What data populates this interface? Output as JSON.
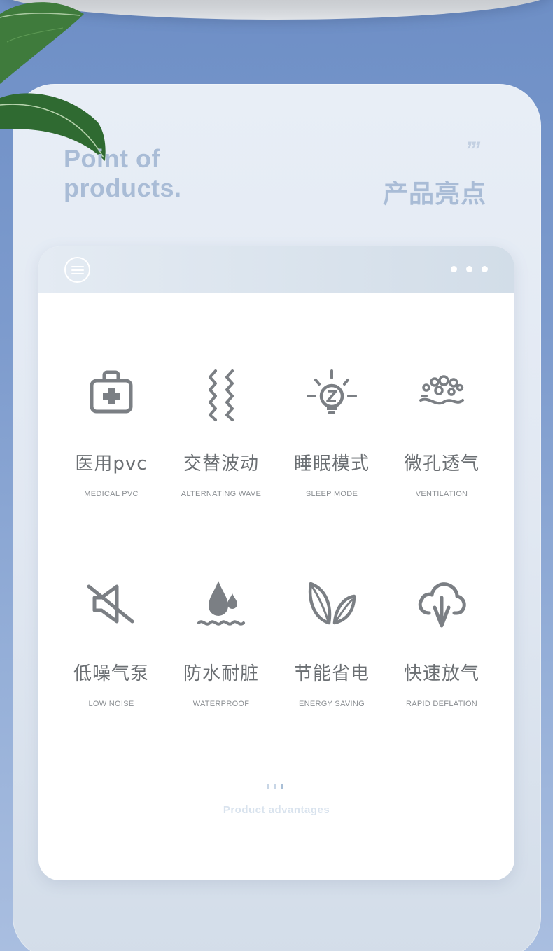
{
  "heading": {
    "title_en_line1": "Point of",
    "title_en_line2": "products.",
    "quote_marks": "’’’",
    "title_cn": "产品亮点"
  },
  "card": {
    "footer_label": "Product advantages"
  },
  "features": [
    {
      "cn": "医用pvc",
      "en": "MEDICAL PVC",
      "icon": "medical-kit-icon"
    },
    {
      "cn": "交替波动",
      "en": "ALTERNATING WAVE",
      "icon": "wave-icon"
    },
    {
      "cn": "睡眠模式",
      "en": "SLEEP MODE",
      "icon": "sleep-bulb-icon"
    },
    {
      "cn": "微孔透气",
      "en": "VENTILATION",
      "icon": "ventilation-icon"
    },
    {
      "cn": "低噪气泵",
      "en": "LOW NOISE",
      "icon": "mute-speaker-icon"
    },
    {
      "cn": "防水耐脏",
      "en": "WATERPROOF",
      "icon": "water-drop-icon"
    },
    {
      "cn": "节能省电",
      "en": "ENERGY SAVING",
      "icon": "leaves-icon"
    },
    {
      "cn": "快速放气",
      "en": "RAPID DEFLATION",
      "icon": "cloud-deflate-icon"
    }
  ],
  "colors": {
    "icon_gray": "#7b7f84",
    "title_blue": "#a9bcd6",
    "background_blue": "#7d9bcd"
  }
}
